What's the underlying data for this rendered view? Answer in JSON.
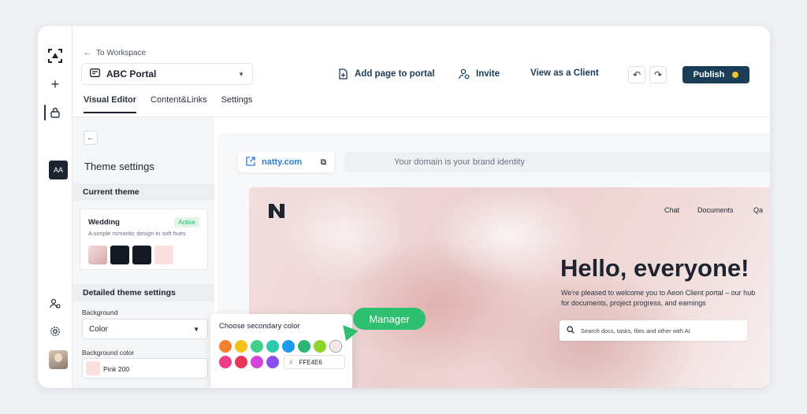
{
  "header": {
    "breadcrumb": "To Workspace",
    "portal_name": "ABC Portal",
    "add_page_label": "Add page to portal",
    "invite_label": "Invite",
    "view_as_client_label": "View as a Client",
    "publish_label": "Publish"
  },
  "rail": {
    "workspace_initials": "AA"
  },
  "tabs": [
    "Visual Editor",
    "Content&Links",
    "Settings"
  ],
  "panel": {
    "title": "Theme settings",
    "current_theme_heading": "Current theme",
    "theme_name": "Wedding",
    "theme_status": "Active",
    "theme_description": "A simple romantic design in soft hues",
    "theme_swatches": [
      "#e9c9c9",
      "#141a24",
      "#141a24",
      "#fbe0e0"
    ],
    "detailed_heading": "Detailed theme settings",
    "background_label": "Background",
    "background_value": "Color",
    "background_color_label": "Background color",
    "background_color_value": "Pink 200"
  },
  "preview": {
    "domain": "natty.com",
    "domain_hint": "Your domain is your brand identity",
    "nav": [
      "Chat",
      "Documents",
      "Qa"
    ],
    "headline": "Hello, everyone!",
    "subtext": "We're pleased to welcome you to Aeon Client portal – our hub for documents, project progress, and earnings",
    "search_placeholder": "Search docs, tasks, files and other with AI"
  },
  "picker": {
    "title": "Choose secondary color",
    "colors_row1": [
      "#f5802a",
      "#f6c21c",
      "#43d089",
      "#2ec9b0",
      "#1a9bf0",
      "#2bb574",
      "#8fd42a",
      "#fbe4e6"
    ],
    "colors_row2": [
      "#ee3e8a",
      "#e8365a",
      "#d344d8",
      "#8a4ff0"
    ],
    "hex_value": "FFE4E6"
  },
  "cursor_label": "Manager",
  "colors": {
    "primary": "#1b3d55",
    "accent_green": "#2fbf71",
    "publish_dot": "#f4c430"
  }
}
